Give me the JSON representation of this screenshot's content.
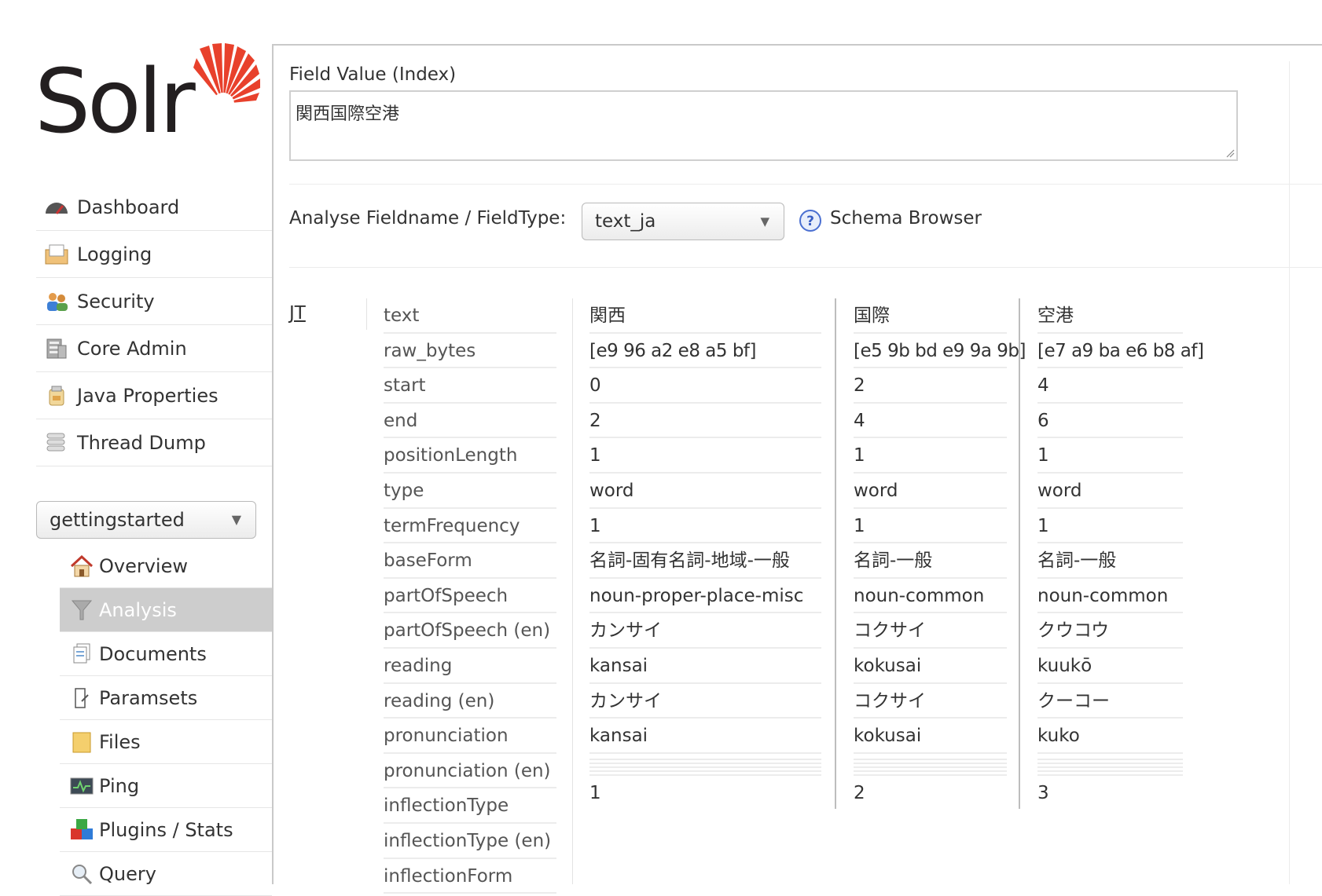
{
  "logo": {
    "text": "Solr"
  },
  "main_nav": [
    {
      "label": "Dashboard",
      "icon": "dashboard-icon"
    },
    {
      "label": "Logging",
      "icon": "logging-icon"
    },
    {
      "label": "Security",
      "icon": "security-icon"
    },
    {
      "label": "Core Admin",
      "icon": "core-admin-icon"
    },
    {
      "label": "Java Properties",
      "icon": "java-properties-icon"
    },
    {
      "label": "Thread Dump",
      "icon": "thread-dump-icon"
    }
  ],
  "core_selector": {
    "value": "gettingstarted"
  },
  "core_nav": [
    {
      "label": "Overview",
      "icon": "overview-icon"
    },
    {
      "label": "Analysis",
      "icon": "analysis-icon",
      "active": true
    },
    {
      "label": "Documents",
      "icon": "documents-icon"
    },
    {
      "label": "Paramsets",
      "icon": "paramsets-icon"
    },
    {
      "label": "Files",
      "icon": "files-icon"
    },
    {
      "label": "Ping",
      "icon": "ping-icon"
    },
    {
      "label": "Plugins / Stats",
      "icon": "plugins-icon"
    },
    {
      "label": "Query",
      "icon": "query-icon"
    }
  ],
  "analysis": {
    "field_value_label": "Field Value (Index)",
    "field_value": "関西国際空港",
    "fieldtype_label": "Analyse Fieldname / FieldType:",
    "fieldtype_value": "text_ja",
    "schema_browser_label": "Schema Browser",
    "analyzer_abbrev": "JT",
    "properties": [
      "text",
      "raw_bytes",
      "start",
      "end",
      "positionLength",
      "type",
      "termFrequency",
      "baseForm",
      "partOfSpeech",
      "partOfSpeech (en)",
      "reading",
      "reading (en)",
      "pronunciation",
      "pronunciation (en)",
      "inflectionType",
      "inflectionType (en)",
      "inflectionForm"
    ],
    "tokens": [
      {
        "text": "関西",
        "raw_bytes": "[e9 96 a2 e8 a5 bf]",
        "start": "0",
        "end": "2",
        "positionLength": "1",
        "type": "word",
        "termFrequency": "1",
        "baseForm": "名詞-固有名詞-地域-一般",
        "partOfSpeech": "noun-proper-place-misc",
        "partOfSpeech_en": "カンサイ",
        "reading": "kansai",
        "reading_en": "カンサイ",
        "pronunciation": "kansai",
        "position": "1"
      },
      {
        "text": "国際",
        "raw_bytes": "[e5 9b bd e9 9a 9b]",
        "start": "2",
        "end": "4",
        "positionLength": "1",
        "type": "word",
        "termFrequency": "1",
        "baseForm": "名詞-一般",
        "partOfSpeech": "noun-common",
        "partOfSpeech_en": "コクサイ",
        "reading": "kokusai",
        "reading_en": "コクサイ",
        "pronunciation": "kokusai",
        "position": "2"
      },
      {
        "text": "空港",
        "raw_bytes": "[e7 a9 ba e6 b8 af]",
        "start": "4",
        "end": "6",
        "positionLength": "1",
        "type": "word",
        "termFrequency": "1",
        "baseForm": "名詞-一般",
        "partOfSpeech": "noun-common",
        "partOfSpeech_en": "クウコウ",
        "reading": "kuukō",
        "reading_en": "クーコー",
        "pronunciation": "kuko",
        "position": "3"
      }
    ]
  }
}
